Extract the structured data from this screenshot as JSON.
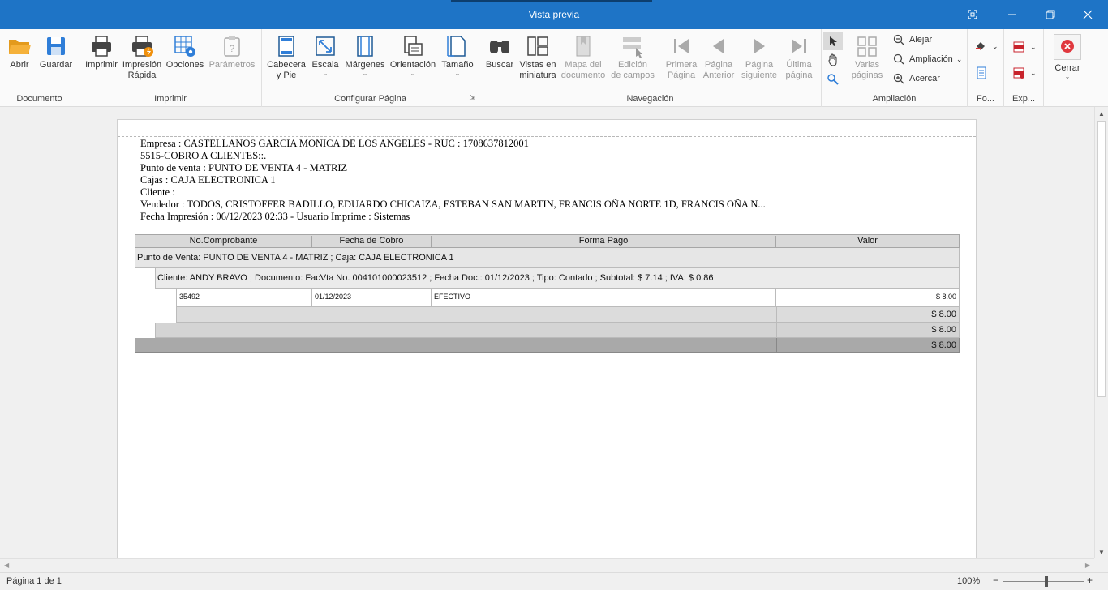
{
  "window": {
    "title": "Vista previa"
  },
  "ribbon": {
    "groups": {
      "documento": "Documento",
      "imprimir": "Imprimir",
      "configurar": "Configurar Página",
      "navegacion": "Navegación",
      "ampliacion": "Ampliación",
      "fondo": "Fo...",
      "exportar": "Exp..."
    },
    "buttons": {
      "abrir": "Abrir",
      "guardar": "Guardar",
      "imprimir": "Imprimir",
      "impresion_rapida_1": "Impresión",
      "impresion_rapida_2": "Rápida",
      "opciones": "Opciones",
      "parametros": "Parámetros",
      "cabecera_1": "Cabecera",
      "cabecera_2": "y Pie",
      "escala": "Escala",
      "margenes": "Márgenes",
      "orientacion": "Orientación",
      "tamano": "Tamaño",
      "buscar": "Buscar",
      "vistas_1": "Vistas en",
      "vistas_2": "miniatura",
      "mapa_1": "Mapa del",
      "mapa_2": "documento",
      "edicion_1": "Edición",
      "edicion_2": "de campos",
      "primera_1": "Primera",
      "primera_2": "Página",
      "anterior_1": "Página",
      "anterior_2": "Anterior",
      "siguiente_1": "Página",
      "siguiente_2": "siguiente",
      "ultima_1": "Última",
      "ultima_2": "página",
      "varias_1": "Varias",
      "varias_2": "páginas",
      "alejar": "Alejar",
      "ampliacion": "Ampliación",
      "acercar": "Acercar",
      "cerrar": "Cerrar"
    }
  },
  "report": {
    "header_lines": [
      "Empresa : CASTELLANOS GARCIA MONICA DE LOS ANGELES  -  RUC : 1708637812001",
      "5515-COBRO A CLIENTES::.",
      "Punto de venta : PUNTO DE VENTA 4 - MATRIZ",
      "Cajas : CAJA ELECTRONICA 1",
      "Cliente :",
      "Vendedor :  TODOS, CRISTOFFER BADILLO, EDUARDO CHICAIZA, ESTEBAN SAN MARTIN, FRANCIS OÑA NORTE 1D, FRANCIS OÑA N...",
      "Fecha Impresión : 06/12/2023 02:33  -  Usuario Imprime : Sistemas"
    ],
    "columns": [
      "No.Comprobante",
      "Fecha de Cobro",
      "Forma Pago",
      "Valor"
    ],
    "group1": "Punto de Venta: PUNTO DE VENTA 4 - MATRIZ ; Caja: CAJA ELECTRONICA 1",
    "group2": "Cliente: ANDY BRAVO ; Documento: FacVta No. 004101000023512 ; Fecha Doc.: 01/12/2023 ; Tipo: Contado ; Subtotal: $ 7.14 ; IVA: $ 0.86",
    "row": {
      "comprobante": "35492",
      "fecha": "01/12/2023",
      "forma": "EFECTIVO",
      "valor": "$ 8.00"
    },
    "subtotal_doc": "$ 8.00",
    "subtotal_cliente": "$ 8.00",
    "total": "$ 8.00"
  },
  "status": {
    "page": "Página 1 de 1",
    "zoom": "100%"
  }
}
